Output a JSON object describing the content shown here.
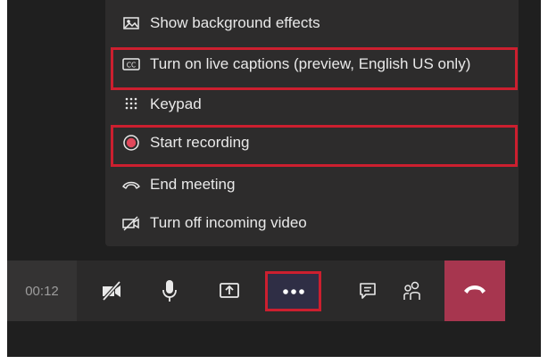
{
  "menu": {
    "items": [
      {
        "label": "Show background effects",
        "icon": "background-effects-icon"
      },
      {
        "label": "Turn on live captions (preview, English US only)",
        "icon": "captions-icon"
      },
      {
        "label": "Keypad",
        "icon": "keypad-icon"
      },
      {
        "label": "Start recording",
        "icon": "record-icon"
      },
      {
        "label": "End meeting",
        "icon": "end-meeting-icon"
      },
      {
        "label": "Turn off incoming video",
        "icon": "video-off-icon"
      }
    ]
  },
  "toolbar": {
    "timer": "00:12",
    "buttons": [
      {
        "icon": "camera-off-icon"
      },
      {
        "icon": "microphone-icon"
      },
      {
        "icon": "share-screen-icon"
      },
      {
        "icon": "more-options-icon"
      },
      {
        "icon": "chat-icon"
      },
      {
        "icon": "participants-icon"
      },
      {
        "icon": "hang-up-icon"
      }
    ]
  },
  "colors": {
    "highlight": "#cc1f2f",
    "hangup": "#a7364f",
    "record": "#e0485b"
  }
}
